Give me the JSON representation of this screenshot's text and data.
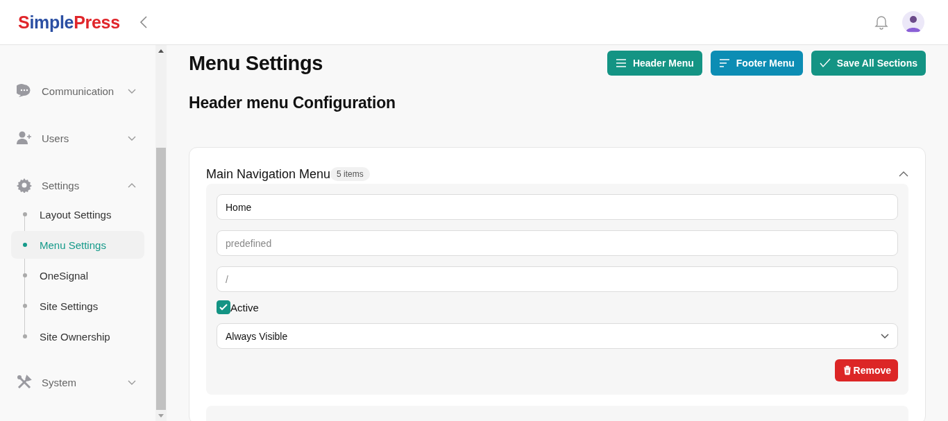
{
  "header": {
    "logo_first": "S",
    "logo_rest": "imple",
    "logo_second": "Press"
  },
  "sidebar": {
    "items": [
      {
        "label": "Communication",
        "expanded": false
      },
      {
        "label": "Users",
        "expanded": false
      },
      {
        "label": "Settings",
        "expanded": true,
        "children": [
          {
            "label": "Layout Settings",
            "selected": false
          },
          {
            "label": "Menu Settings",
            "selected": true
          },
          {
            "label": "OneSignal",
            "selected": false
          },
          {
            "label": "Site Settings",
            "selected": false
          },
          {
            "label": "Site Ownership",
            "selected": false
          }
        ]
      },
      {
        "label": "System",
        "expanded": false
      }
    ]
  },
  "page": {
    "title": "Menu Settings",
    "buttons": [
      {
        "label": "Header Menu",
        "kind": "header"
      },
      {
        "label": "Footer Menu",
        "kind": "footer"
      },
      {
        "label": "Save All Sections",
        "kind": "save"
      }
    ],
    "section_title": "Header menu Configuration",
    "card": {
      "title": "Main Navigation Menu",
      "count": "5 items",
      "expanded": true,
      "item": {
        "fields": [
          {
            "kind": "input",
            "value": "Home"
          },
          {
            "kind": "input",
            "placeholder": "predefined"
          },
          {
            "kind": "input",
            "placeholder": "/"
          },
          {
            "kind": "checkbox",
            "label": "Active",
            "checked": true
          },
          {
            "kind": "select",
            "value": "Always Visible"
          }
        ],
        "remove": "Remove"
      }
    }
  }
}
